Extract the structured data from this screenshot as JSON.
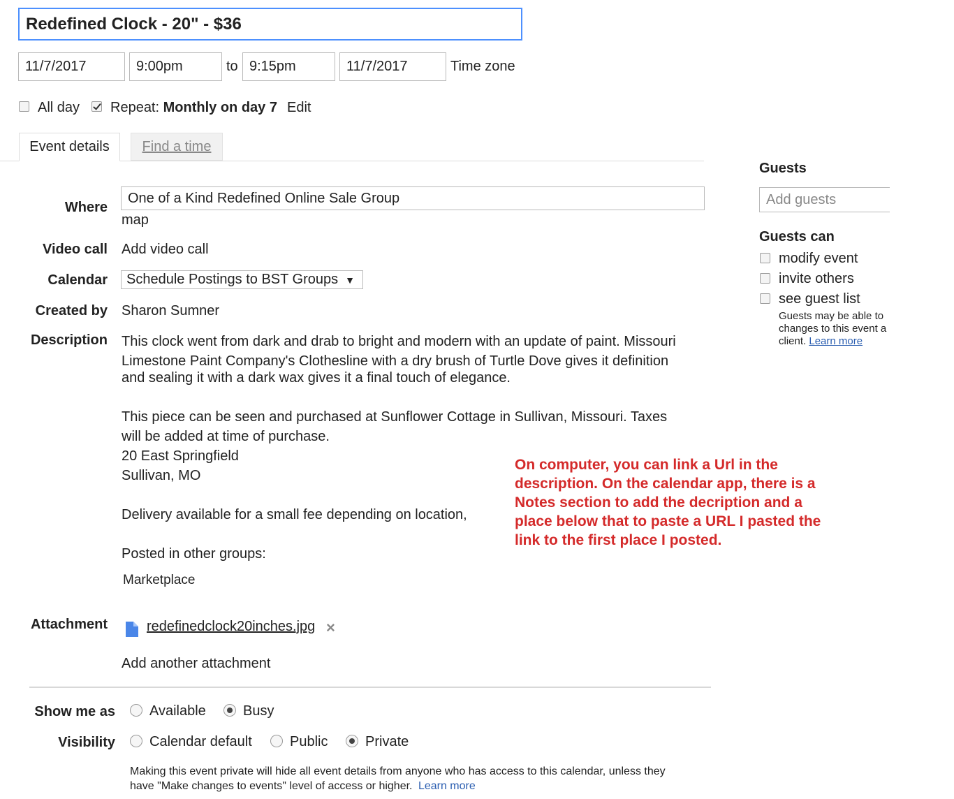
{
  "title": "Redefined Clock - 20\" - $36",
  "datetime": {
    "start_date": "11/7/2017",
    "start_time": "9:00pm",
    "to_label": "to",
    "end_time": "9:15pm",
    "end_date": "11/7/2017",
    "timezone_link": "Time zone"
  },
  "options": {
    "all_day_label": "All day",
    "all_day_checked": false,
    "repeat_checked": true,
    "repeat_label": "Repeat:",
    "repeat_value": "Monthly on day 7",
    "edit_link": "Edit"
  },
  "tabs": [
    {
      "label": "Event details",
      "active": true
    },
    {
      "label": "Find a time",
      "active": false
    }
  ],
  "details": {
    "where_label": "Where",
    "where_value": "One of a Kind Redefined Online Sale Group",
    "map_link": "map",
    "video_label": "Video call",
    "video_link": "Add video call",
    "calendar_label": "Calendar",
    "calendar_value": "Schedule Postings to BST Groups",
    "created_label": "Created by",
    "created_value": "Sharon Sumner",
    "description_label": "Description",
    "description_lines": [
      "This clock went from dark and drab to bright and modern with an update of paint. Missouri",
      "Limestone Paint Company's Clothesline with a dry brush of Turtle Dove gives it definition",
      "and sealing it with a dark wax gives it a final touch of elegance.",
      "This piece can be seen and purchased at Sunflower Cottage in Sullivan, Missouri. Taxes",
      "will be added at time of purchase.",
      "20 East Springfield",
      "Sullivan, MO",
      "Delivery available for a small fee depending on location,",
      "Posted in other groups:",
      "Marketplace"
    ],
    "attachment_label": "Attachment",
    "attachment_file": "redefinedclock20inches.jpg",
    "add_attachment_link": "Add another attachment"
  },
  "annotation": "On computer, you can link a Url in the description.  On the calendar app, there is a Notes section to add the decription and a place below that to paste a URL  I pasted the link to the first place I posted.",
  "show_me_as": {
    "label": "Show me as",
    "options": [
      {
        "label": "Available",
        "selected": false
      },
      {
        "label": "Busy",
        "selected": true
      }
    ]
  },
  "visibility": {
    "label": "Visibility",
    "options": [
      {
        "label": "Calendar default",
        "selected": false
      },
      {
        "label": "Public",
        "selected": false
      },
      {
        "label": "Private",
        "selected": true
      }
    ],
    "note_line1": "Making this event private will hide all event details from anyone who has access to this calendar, unless they",
    "note_line2": "have \"Make changes to events\" level of access or higher.",
    "learn_more": "Learn more"
  },
  "guests": {
    "title": "Guests",
    "input_placeholder": "Add guests",
    "can_title": "Guests can",
    "permissions": [
      {
        "label": "modify event",
        "checked": false
      },
      {
        "label": "invite others",
        "checked": false
      },
      {
        "label": "see guest list",
        "checked": false
      }
    ],
    "note_line1": "Guests may be able to",
    "note_line2": "changes to this event a",
    "note_line3": "client.",
    "learn_more": "Learn more"
  },
  "colors": {
    "link": "#2a5db0",
    "annotation": "#d42a2a",
    "title_border": "#4d90fe"
  }
}
